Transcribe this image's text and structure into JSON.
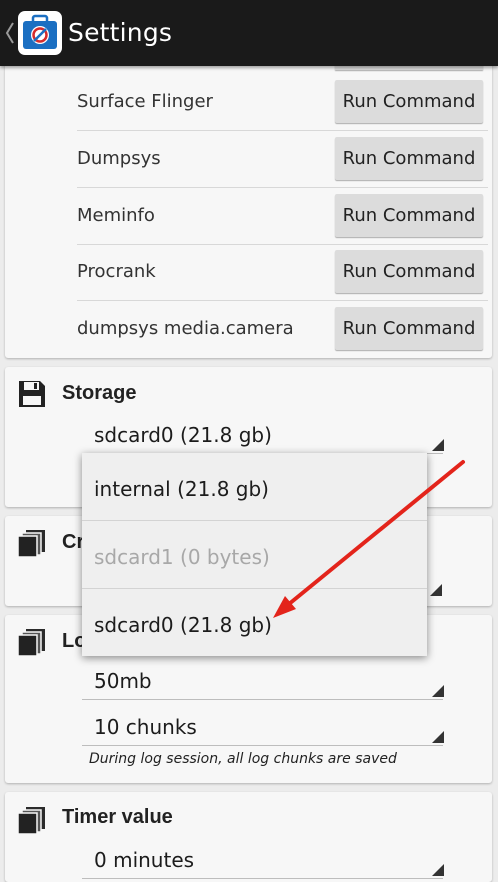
{
  "actionbar": {
    "title": "Settings",
    "up_icon": "chevron-left-icon",
    "app_icon": "toolbox-icon"
  },
  "commands": {
    "button_label": "Run Command",
    "rows": [
      {
        "label": "Surface Flinger"
      },
      {
        "label": "Dumpsys"
      },
      {
        "label": "Meminfo"
      },
      {
        "label": "Procrank"
      },
      {
        "label": "dumpsys media.camera"
      }
    ]
  },
  "storage": {
    "title": "Storage",
    "icon": "floppy-disk-icon",
    "selected": "sdcard0 (21.8 gb)",
    "options": [
      {
        "label": "internal (21.8 gb)",
        "enabled": true
      },
      {
        "label": "sdcard1 (0 bytes)",
        "enabled": false
      },
      {
        "label": "sdcard0 (21.8 gb)",
        "enabled": true
      }
    ]
  },
  "crash_section": {
    "title_fragment": "Cr",
    "icon": "copy-pages-icon"
  },
  "log_section": {
    "title_fragment": "Lo",
    "icon": "copy-pages-icon",
    "chunk_size": "50mb",
    "chunk_count": "10 chunks",
    "helper_text": "During log session, all log chunks are saved"
  },
  "timer_section": {
    "title": "Timer value",
    "icon": "copy-pages-icon",
    "value": "0 minutes"
  },
  "colors": {
    "actionbar": "#1a1a1a",
    "card": "#f7f7f7",
    "popup": "#efefef",
    "annotation_arrow": "#e3241b"
  }
}
